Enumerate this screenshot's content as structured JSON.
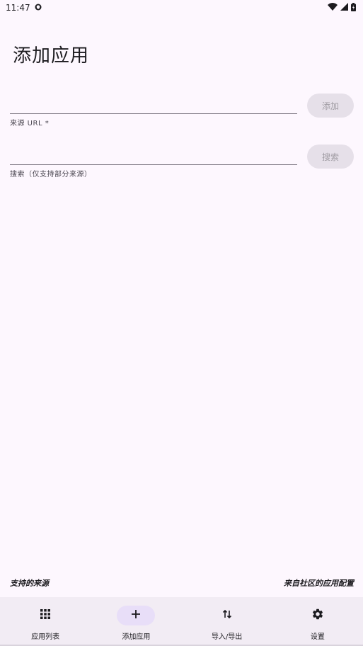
{
  "status": {
    "time": "11:47"
  },
  "page": {
    "title": "添加应用"
  },
  "source_url": {
    "label": "来源 URL *",
    "value": "",
    "button": "添加"
  },
  "search": {
    "label": "搜索（仅支持部分来源）",
    "value": "",
    "button": "搜索"
  },
  "links": {
    "supported_sources": "支持的来源",
    "community_configs": "来自社区的应用配置"
  },
  "nav": {
    "items": [
      {
        "label": "应用列表",
        "icon": "grid-icon"
      },
      {
        "label": "添加应用",
        "icon": "plus-icon"
      },
      {
        "label": "导入/导出",
        "icon": "swap-vertical-icon"
      },
      {
        "label": "设置",
        "icon": "gear-icon"
      }
    ]
  },
  "colors": {
    "background": "#fdf7fe",
    "nav_background": "#f2ecf4",
    "active_indicator": "#e8def8",
    "disabled_button": "#e6e0e9"
  }
}
